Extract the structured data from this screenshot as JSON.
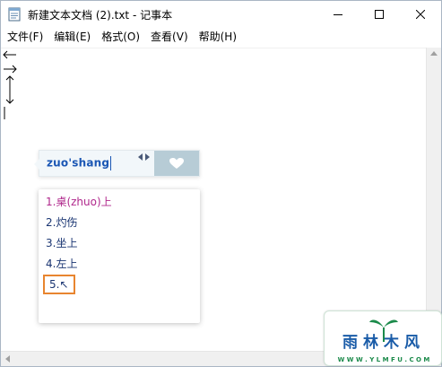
{
  "window": {
    "title": "新建文本文档 (2).txt - 记事本"
  },
  "menu": [
    "文件(F)",
    "编辑(E)",
    "格式(O)",
    "查看(V)",
    "帮助(H)"
  ],
  "ime": {
    "pinyin": "zuo'shang",
    "candidates": [
      "1.桌(zhuo)上",
      "2.灼伤",
      "3.坐上",
      "4.左上",
      "5.↖"
    ],
    "active_index": 0,
    "highlighted_index": 4
  },
  "colors": {
    "active_candidate": "#b0288c",
    "candidate": "#1a3572",
    "highlight_box": "#e8852f",
    "pinyin": "#1a56b4",
    "ime_skin": "#b7ccd6"
  },
  "icons": {
    "app": "notepad-icon",
    "minimize": "minimize-icon",
    "maximize": "maximize-icon",
    "close": "close-icon",
    "ime_skin": "heart-icon",
    "watermark": "watermark-logo"
  },
  "watermark": {
    "brand": "雨林木风",
    "url": "W W W . Y L M F U . C O M"
  }
}
